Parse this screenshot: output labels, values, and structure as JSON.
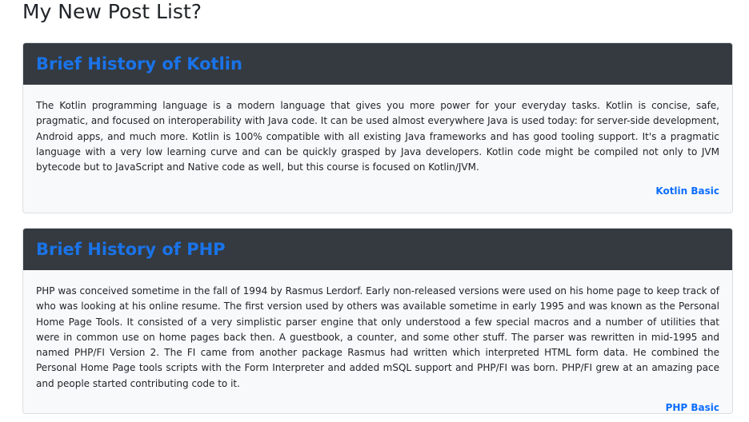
{
  "page": {
    "title": "My New Post List?"
  },
  "posts": [
    {
      "title": "Brief History of Kotlin",
      "body": "The Kotlin programming language is a modern language that gives you more power for your everyday tasks. Kotlin is concise, safe, pragmatic, and focused on interoperability with Java code. It can be used almost everywhere Java is used today: for server-side development, Android apps, and much more. Kotlin is 100% compatible with all existing Java frameworks and has good tooling support. It's a pragmatic language with a very low learning curve and can be quickly grasped by Java developers. Kotlin code might be compiled not only to JVM bytecode but to JavaScript and Native code as well, but this course is focused on Kotlin/JVM.",
      "tag": "Kotlin Basic"
    },
    {
      "title": "Brief History of PHP",
      "body": "PHP was conceived sometime in the fall of 1994 by Rasmus Lerdorf. Early non-released versions were used on his home page to keep track of who was looking at his online resume. The first version used by others was available sometime in early 1995 and was known as the Personal Home Page Tools. It consisted of a very simplistic parser engine that only understood a few special macros and a number of utilities that were in common use on home pages back then. A guestbook, a counter, and some other stuff. The parser was rewritten in mid-1995 and named PHP/FI Version 2. The FI came from another package Rasmus had written which interpreted HTML form data. He combined the Personal Home Page tools scripts with the Form Interpreter and added mSQL support and PHP/FI was born. PHP/FI grew at an amazing pace and people started contributing code to it.",
      "tag": "PHP Basic"
    }
  ]
}
